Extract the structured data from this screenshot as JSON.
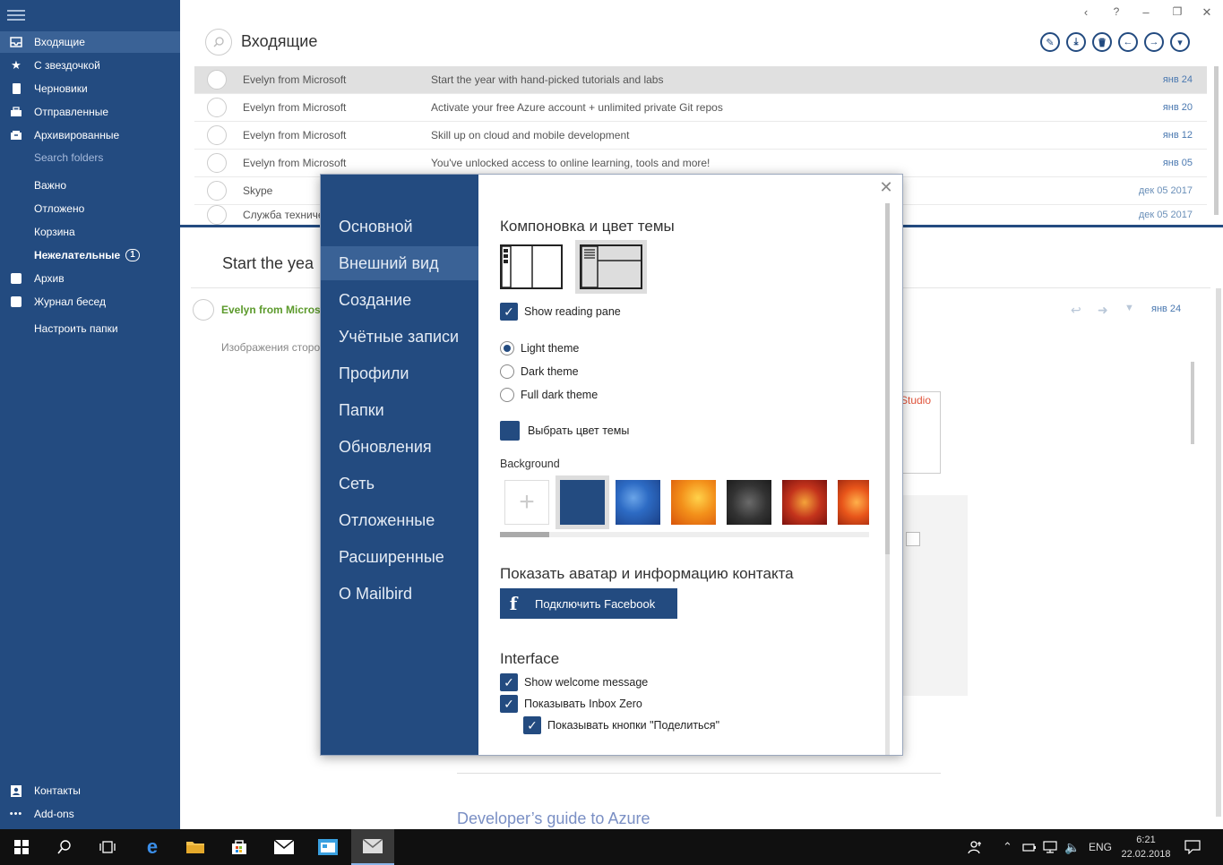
{
  "sidebar": {
    "folders": [
      {
        "label": "Входящие",
        "icon": "inbox-icon",
        "active": true
      },
      {
        "label": "С звездочкой",
        "icon": "star-icon"
      },
      {
        "label": "Черновики",
        "icon": "draft-icon"
      },
      {
        "label": "Отправленные",
        "icon": "sent-icon"
      },
      {
        "label": "Архивированные",
        "icon": "archive-icon"
      }
    ],
    "search_folders": "Search folders",
    "tags": [
      {
        "label": "Важно"
      },
      {
        "label": "Отложено"
      },
      {
        "label": "Корзина"
      },
      {
        "label": "Нежелательные",
        "badge": "1"
      }
    ],
    "extra": [
      {
        "label": "Архив",
        "icon": "folder-icon"
      },
      {
        "label": "Журнал бесед",
        "icon": "folder-icon"
      }
    ],
    "configure": "Настроить папки",
    "bottom": [
      {
        "label": "Контакты",
        "icon": "contacts-icon"
      },
      {
        "label": "Add-ons",
        "icon": "more-icon"
      }
    ]
  },
  "window_controls": {
    "back": "‹",
    "help": "?",
    "minimize": "–",
    "restore": "❐",
    "close": "✕"
  },
  "header": {
    "folder_title": "Входящие"
  },
  "toolbar": {
    "compose": "✎",
    "download": "⤓",
    "delete": "🗑",
    "reply": "←",
    "forward": "→",
    "more": "▾"
  },
  "mail_list": [
    {
      "from": "Evelyn from Microsoft",
      "subject": "Start the year with hand-picked tutorials and labs",
      "date": "янв 24",
      "selected": true
    },
    {
      "from": "Evelyn from Microsoft",
      "subject": "Activate your free Azure account + unlimited private Git repos",
      "date": "янв 20"
    },
    {
      "from": "Evelyn from Microsoft",
      "subject": "Skill up on cloud and mobile development",
      "date": "янв 12"
    },
    {
      "from": "Evelyn from Microsoft",
      "subject": "You've unlocked access to online learning, tools and more!",
      "date": "янв 05"
    },
    {
      "from": "Skype",
      "subject": "",
      "date": "дек 05 2017"
    },
    {
      "from": "Служба техниче",
      "subject": "",
      "date": "дек 05 2017"
    }
  ],
  "reading": {
    "title": "Start the yea",
    "sender": "Evelyn from Microso",
    "date": "янв 24",
    "images_note": "Изображения сторо",
    "studio_text": "Studio",
    "dev_guide": "Developer’s guide to Azure"
  },
  "settings": {
    "nav": [
      {
        "label": "Основной"
      },
      {
        "label": "Внешний вид",
        "active": true
      },
      {
        "label": "Создание"
      },
      {
        "label": "Учётные записи"
      },
      {
        "label": "Профили"
      },
      {
        "label": "Папки"
      },
      {
        "label": "Обновления"
      },
      {
        "label": "Сеть"
      },
      {
        "label": "Отложенные"
      },
      {
        "label": "Расширенные"
      },
      {
        "label": "О Mailbird"
      }
    ],
    "close": "✕",
    "layout_title": "Компоновка и цвет темы",
    "show_reading_pane": "Show reading pane",
    "themes": [
      {
        "label": "Light theme",
        "selected": true
      },
      {
        "label": "Dark theme"
      },
      {
        "label": "Full dark theme"
      }
    ],
    "choose_color": "Выбрать цвет темы",
    "theme_color": "#234b80",
    "background_label": "Background",
    "add_background": "+",
    "avatar_title": "Показать аватар и информацию контакта",
    "facebook_button": "Подключить Facebook",
    "interface_title": "Interface",
    "interface_options": [
      {
        "label": "Show welcome message",
        "checked": true
      },
      {
        "label": "Показывать Inbox Zero",
        "checked": true
      },
      {
        "label": "Показывать кнопки \"Поделиться\"",
        "checked": true
      }
    ]
  },
  "taskbar": {
    "language": "ENG",
    "time": "6:21",
    "date": "22.02.2018"
  }
}
